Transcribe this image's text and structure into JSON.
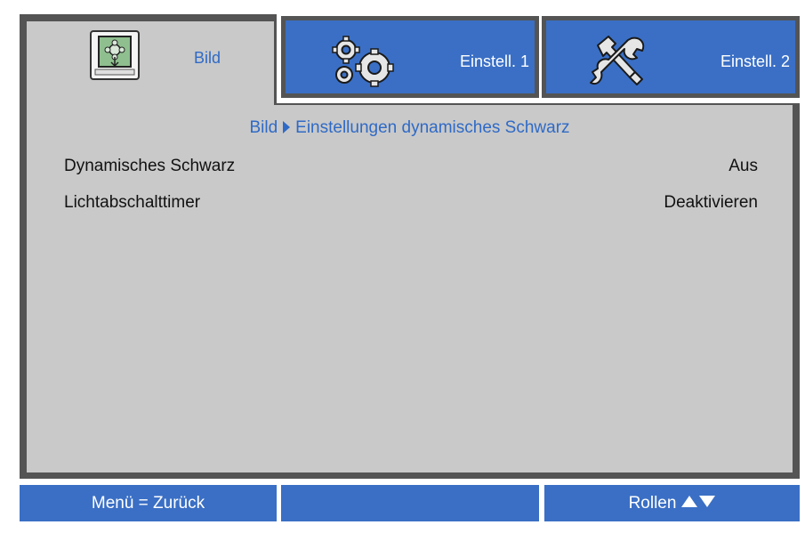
{
  "tabs": [
    {
      "label": "Bild",
      "icon": "picture-icon",
      "active": true
    },
    {
      "label": "Einstell. 1",
      "icon": "gears-icon",
      "active": false
    },
    {
      "label": "Einstell. 2",
      "icon": "tools-icon",
      "active": false
    }
  ],
  "breadcrumb": {
    "parent": "Bild",
    "current": "Einstellungen dynamisches Schwarz"
  },
  "settings": [
    {
      "label": "Dynamisches Schwarz",
      "value": "Aus"
    },
    {
      "label": "Lichtabschalttimer",
      "value": "Deaktivieren"
    }
  ],
  "footer": {
    "back_hint": "Menü = Zurück",
    "middle": "",
    "scroll_hint": "Rollen"
  },
  "colors": {
    "accent_blue": "#3a6fc5",
    "text_blue": "#2f6ac6",
    "panel_gray": "#c9c9c9",
    "frame_dark": "#545454"
  }
}
